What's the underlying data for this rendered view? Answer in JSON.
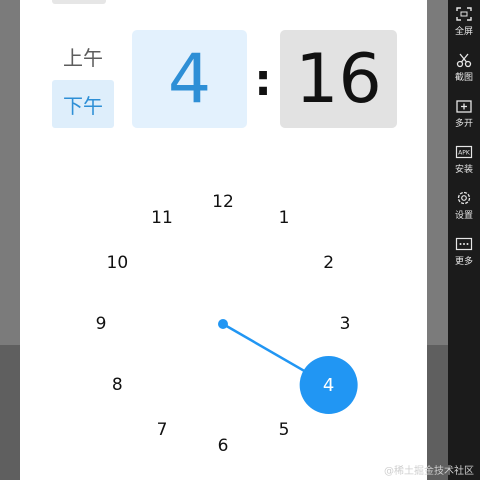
{
  "picker": {
    "am_label": "上午",
    "pm_label": "下午",
    "hour": "4",
    "separator": ":",
    "minute": "16",
    "accent_color": "#2196f3"
  },
  "clock": {
    "numbers": [
      "12",
      "1",
      "2",
      "3",
      "4",
      "5",
      "6",
      "7",
      "8",
      "9",
      "10",
      "11"
    ],
    "selected_hour": "4"
  },
  "sidebar": {
    "items": [
      {
        "label": "全屏",
        "icon": "fullscreen-icon"
      },
      {
        "label": "截图",
        "icon": "scissors-icon"
      },
      {
        "label": "多开",
        "icon": "multi-window-icon"
      },
      {
        "label": "安装",
        "icon": "apk-install-icon"
      },
      {
        "label": "设置",
        "icon": "gear-icon"
      },
      {
        "label": "更多",
        "icon": "more-icon"
      }
    ]
  },
  "watermark": "@稀土掘金技术社区"
}
